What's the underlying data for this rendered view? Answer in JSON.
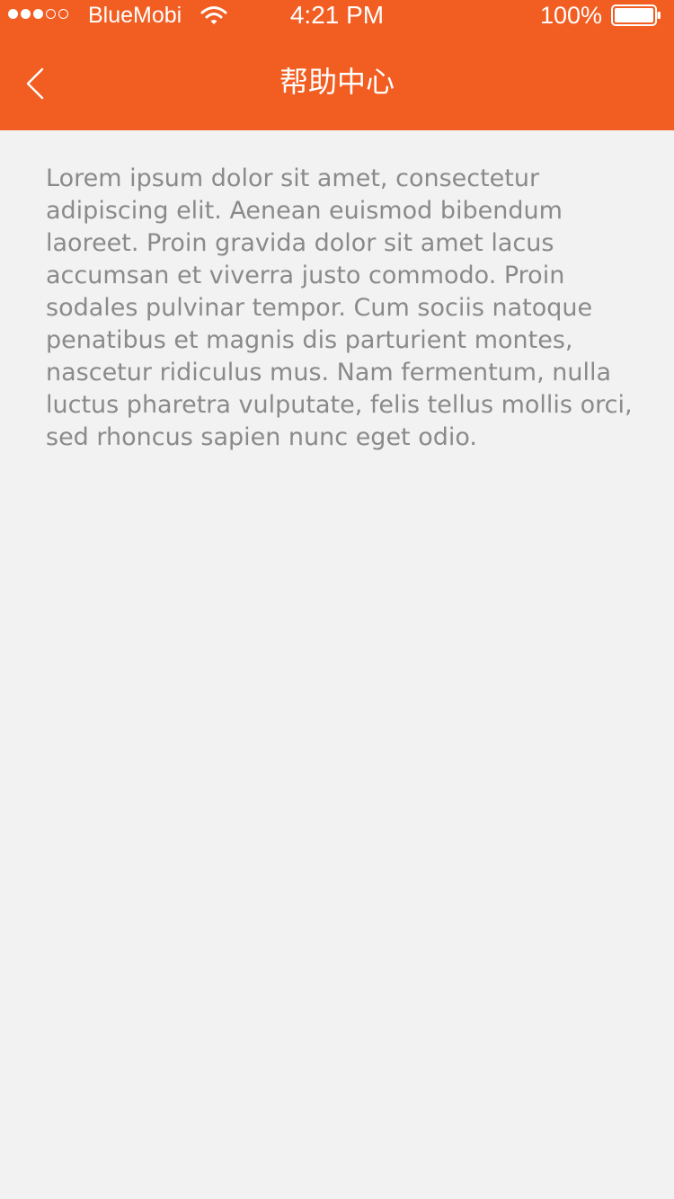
{
  "status_bar": {
    "carrier": "BlueMobi",
    "time": "4:21 PM",
    "battery": "100%",
    "signal_bars_filled": 3,
    "signal_bars_total": 5
  },
  "nav": {
    "title": "帮助中心",
    "back_icon": "chevron-left-icon"
  },
  "help": {
    "body": "Lorem ipsum dolor sit amet, consectetur adipiscing elit. Aenean euismod bibendum laoreet. Proin gravida dolor sit amet lacus accumsan et viverra justo commodo. Proin sodales pulvinar tempor. Cum sociis natoque penatibus et magnis dis parturient montes, nascetur ridiculus mus. Nam fermentum, nulla luctus pharetra vulputate, felis tellus mollis orci, sed rhoncus sapien nunc eget odio."
  },
  "colors": {
    "accent": "#f25d22",
    "background": "#f2f2f2",
    "body_text": "#8a8a8a"
  }
}
